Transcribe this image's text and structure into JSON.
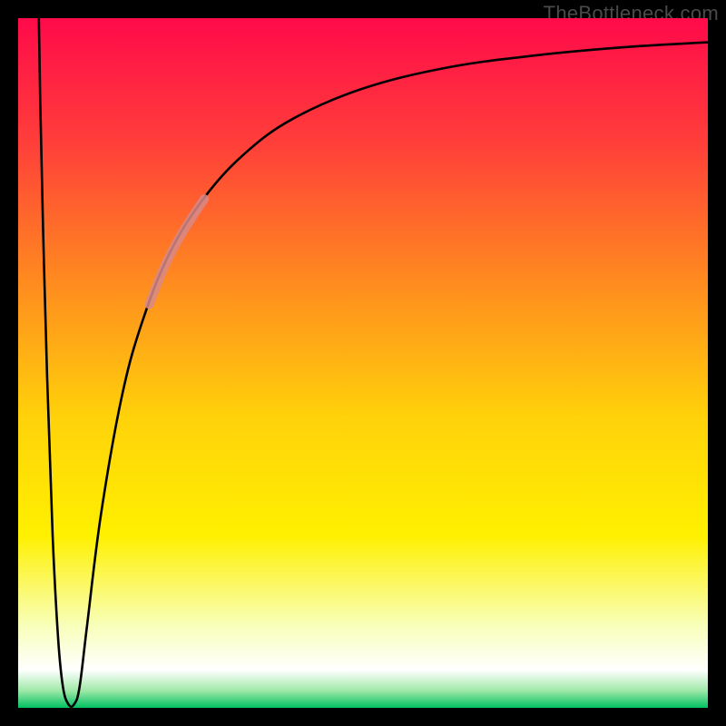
{
  "watermark": "TheBottleneck.com",
  "chart_data": {
    "type": "line",
    "title": "",
    "xlabel": "",
    "ylabel": "",
    "xlim": [
      0,
      100
    ],
    "ylim": [
      0,
      100
    ],
    "background_gradient": {
      "stops": [
        {
          "offset": 0.0,
          "color": "#ff0a4a"
        },
        {
          "offset": 0.18,
          "color": "#ff3e3a"
        },
        {
          "offset": 0.38,
          "color": "#ff8a1f"
        },
        {
          "offset": 0.58,
          "color": "#ffd20a"
        },
        {
          "offset": 0.75,
          "color": "#fff000"
        },
        {
          "offset": 0.88,
          "color": "#f8ffb8"
        },
        {
          "offset": 0.945,
          "color": "#ffffff"
        },
        {
          "offset": 0.975,
          "color": "#9fe9a8"
        },
        {
          "offset": 1.0,
          "color": "#00c060"
        }
      ]
    },
    "series": [
      {
        "name": "bottleneck-curve",
        "color": "#000000",
        "width": 2.6,
        "points": [
          {
            "x": 3.0,
            "y": 100.0
          },
          {
            "x": 3.2,
            "y": 88.0
          },
          {
            "x": 3.6,
            "y": 70.0
          },
          {
            "x": 4.2,
            "y": 48.0
          },
          {
            "x": 5.0,
            "y": 25.0
          },
          {
            "x": 5.8,
            "y": 10.0
          },
          {
            "x": 6.5,
            "y": 3.0
          },
          {
            "x": 7.3,
            "y": 0.5
          },
          {
            "x": 8.1,
            "y": 0.5
          },
          {
            "x": 8.9,
            "y": 3.0
          },
          {
            "x": 10.0,
            "y": 12.0
          },
          {
            "x": 12.0,
            "y": 28.0
          },
          {
            "x": 15.0,
            "y": 45.0
          },
          {
            "x": 18.0,
            "y": 56.0
          },
          {
            "x": 22.0,
            "y": 66.0
          },
          {
            "x": 27.0,
            "y": 74.0
          },
          {
            "x": 33.0,
            "y": 80.5
          },
          {
            "x": 40.0,
            "y": 85.5
          },
          {
            "x": 50.0,
            "y": 89.8
          },
          {
            "x": 62.0,
            "y": 92.8
          },
          {
            "x": 75.0,
            "y": 94.6
          },
          {
            "x": 88.0,
            "y": 95.8
          },
          {
            "x": 100.0,
            "y": 96.5
          }
        ]
      },
      {
        "name": "highlight-segment",
        "color": "#d88a88",
        "width": 10,
        "opacity": 0.85,
        "points": [
          {
            "x": 19.0,
            "y": 58.5
          },
          {
            "x": 21.0,
            "y": 63.5
          },
          {
            "x": 23.0,
            "y": 67.5
          },
          {
            "x": 25.0,
            "y": 70.8
          },
          {
            "x": 27.0,
            "y": 73.8
          }
        ]
      }
    ]
  }
}
